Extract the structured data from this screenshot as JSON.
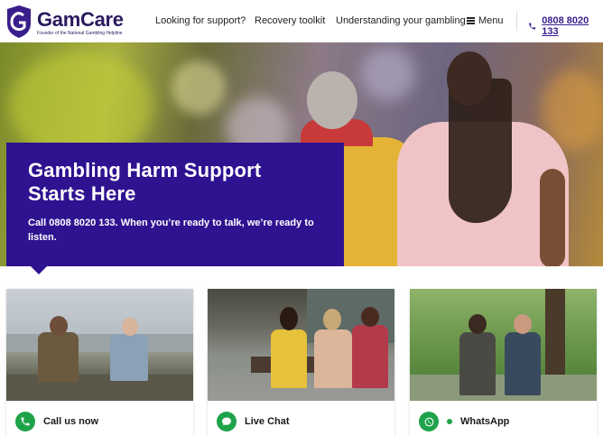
{
  "header": {
    "brand_name": "GamCare",
    "brand_tagline": "Founder of the National Gambling Helpline",
    "nav": [
      {
        "label": "Looking for support?"
      },
      {
        "label": "Recovery toolkit"
      },
      {
        "label": "Understanding your gambling"
      }
    ],
    "menu_label": "Menu",
    "phone_number": "0808 8020 133"
  },
  "hero": {
    "title_line1": "Gambling Harm Support",
    "title_line2": "Starts Here",
    "subtitle": "Call 0808 8020 133. When you’re ready to talk, we’re ready to listen."
  },
  "cards": [
    {
      "label": "Call us now",
      "icon": "phone-icon"
    },
    {
      "label": "Live Chat",
      "icon": "chat-icon"
    },
    {
      "label": "WhatsApp",
      "icon": "whatsapp-icon"
    }
  ],
  "colors": {
    "brand_purple": "#2e1290",
    "accent_green": "#1fa34a",
    "logo_navy": "#2b1a5e"
  }
}
